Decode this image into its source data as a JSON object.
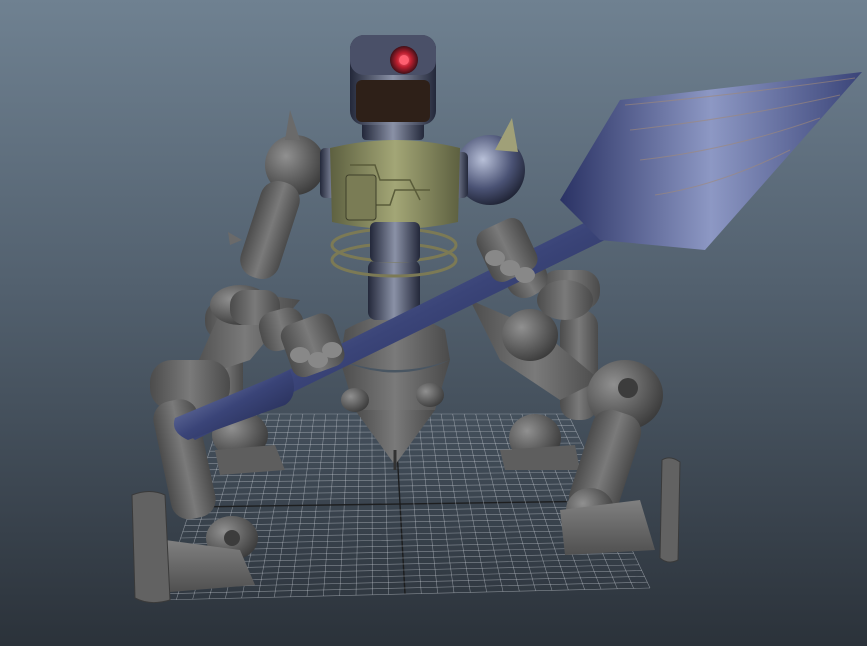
{
  "viewport": {
    "kind": "3d-modeling-viewport",
    "background_top": "#6f8191",
    "background_bottom": "#2b323a",
    "grid_color": "#c8cdd4",
    "grid_axis_color": "#1a1a1a"
  },
  "scene": {
    "subject": "robot-model",
    "parts": [
      "head",
      "eye",
      "torso",
      "shoulder-spikes",
      "arms",
      "hands",
      "spear",
      "pelvis-cone",
      "legs",
      "feet"
    ],
    "colors": {
      "body_gray": "#6f6f6f",
      "body_dark": "#3a3a3a",
      "torso_green": "#8d9264",
      "spear_blue": "#3a4478",
      "spear_light": "#8d98c0",
      "eye_red": "#c02030"
    }
  }
}
